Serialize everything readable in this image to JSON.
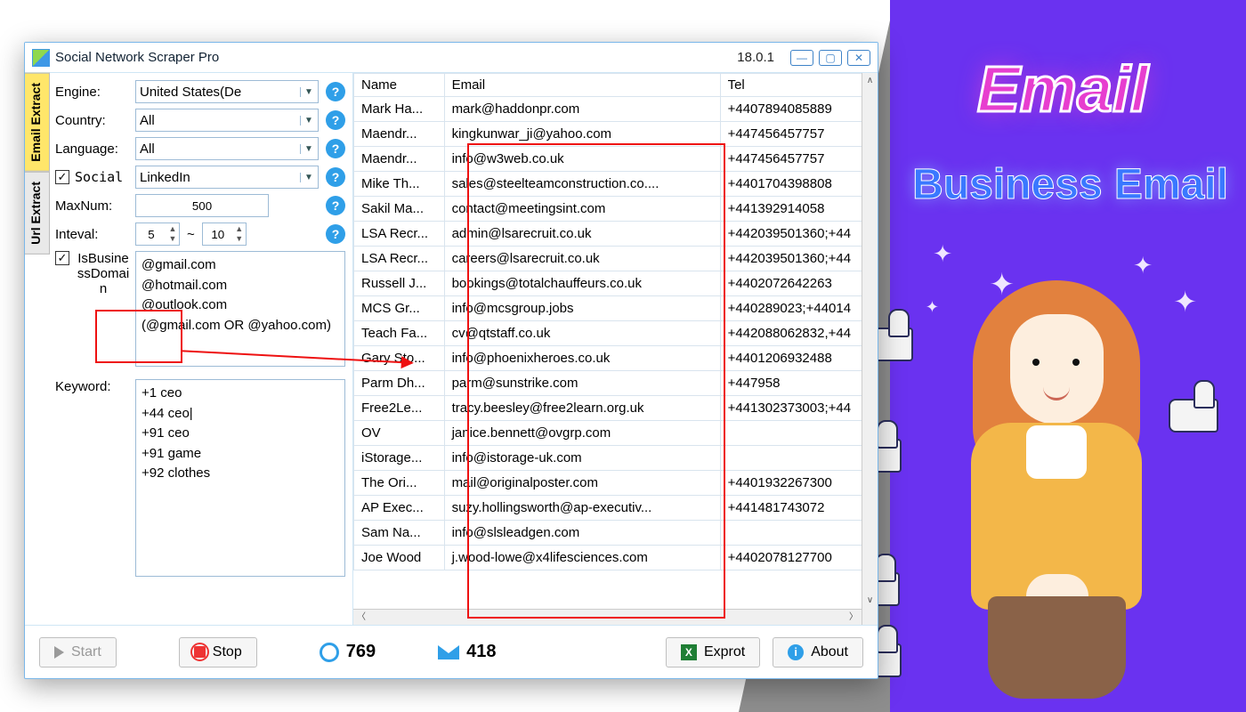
{
  "promo": {
    "email": "Email",
    "business": "Business Email"
  },
  "window": {
    "title": "Social Network Scraper Pro",
    "version": "18.0.1"
  },
  "tabs": {
    "email": "Email Extract",
    "url": "Url Extract"
  },
  "filters": {
    "engine_label": "Engine:",
    "engine_value": "United States(De",
    "country_label": "Country:",
    "country_value": "All",
    "language_label": "Language:",
    "language_value": "All",
    "social_label": "Social",
    "social_value": "LinkedIn",
    "maxnum_label": "MaxNum:",
    "maxnum_value": "500",
    "interval_label": "Inteval:",
    "interval_from": "5",
    "interval_to": "10",
    "interval_sep": "~",
    "isbiz_label": "IsBusinessDomain",
    "domains_text": "@gmail.com\n@hotmail.com\n@outlook.com\n(@gmail.com OR @yahoo.com)",
    "keyword_label": "Keyword:",
    "keyword_text": "+1 ceo\n+44 ceo|\n+91 ceo\n+91 game\n+92 clothes"
  },
  "table": {
    "headers": {
      "name": "Name",
      "email": "Email",
      "tel": "Tel"
    },
    "rows": [
      {
        "name": "Mark Ha...",
        "email": "mark@haddonpr.com",
        "tel": "+4407894085889"
      },
      {
        "name": "Maendr...",
        "email": "kingkunwar_ji@yahoo.com",
        "tel": "+447456457757"
      },
      {
        "name": "Maendr...",
        "email": "info@w3web.co.uk",
        "tel": "+447456457757"
      },
      {
        "name": "Mike Th...",
        "email": "sales@steelteamconstruction.co....",
        "tel": "+4401704398808"
      },
      {
        "name": "Sakil Ma...",
        "email": "contact@meetingsint.com",
        "tel": "+441392914058"
      },
      {
        "name": "LSA Recr...",
        "email": "admin@lsarecruit.co.uk",
        "tel": "+442039501360;+44"
      },
      {
        "name": "LSA Recr...",
        "email": "careers@lsarecruit.co.uk",
        "tel": "+442039501360;+44"
      },
      {
        "name": "Russell J...",
        "email": "bookings@totalchauffeurs.co.uk",
        "tel": "+4402072642263"
      },
      {
        "name": "MCS Gr...",
        "email": "info@mcsgroup.jobs",
        "tel": "+440289023;+44014"
      },
      {
        "name": "Teach Fa...",
        "email": "cv@qtstaff.co.uk",
        "tel": "+442088062832,+44"
      },
      {
        "name": "Gary Sto...",
        "email": "info@phoenixheroes.co.uk",
        "tel": "+4401206932488"
      },
      {
        "name": "Parm Dh...",
        "email": "parm@sunstrike.com",
        "tel": "+447958"
      },
      {
        "name": "Free2Le...",
        "email": "tracy.beesley@free2learn.org.uk",
        "tel": "+441302373003;+44"
      },
      {
        "name": "OV",
        "email": "janice.bennett@ovgrp.com",
        "tel": ""
      },
      {
        "name": "iStorage...",
        "email": "info@istorage-uk.com",
        "tel": ""
      },
      {
        "name": "The Ori...",
        "email": "mail@originalposter.com",
        "tel": "+4401932267300"
      },
      {
        "name": "AP Exec...",
        "email": "suzy.hollingsworth@ap-executiv...",
        "tel": "+441481743072"
      },
      {
        "name": "Sam Na...",
        "email": "info@slsleadgen.com",
        "tel": ""
      },
      {
        "name": "Joe Wood",
        "email": "j.wood-lowe@x4lifesciences.com",
        "tel": "+4402078127700"
      }
    ]
  },
  "bottom": {
    "start": "Start",
    "stop": "Stop",
    "links": "769",
    "emails": "418",
    "export": "Exprot",
    "about": "About"
  }
}
